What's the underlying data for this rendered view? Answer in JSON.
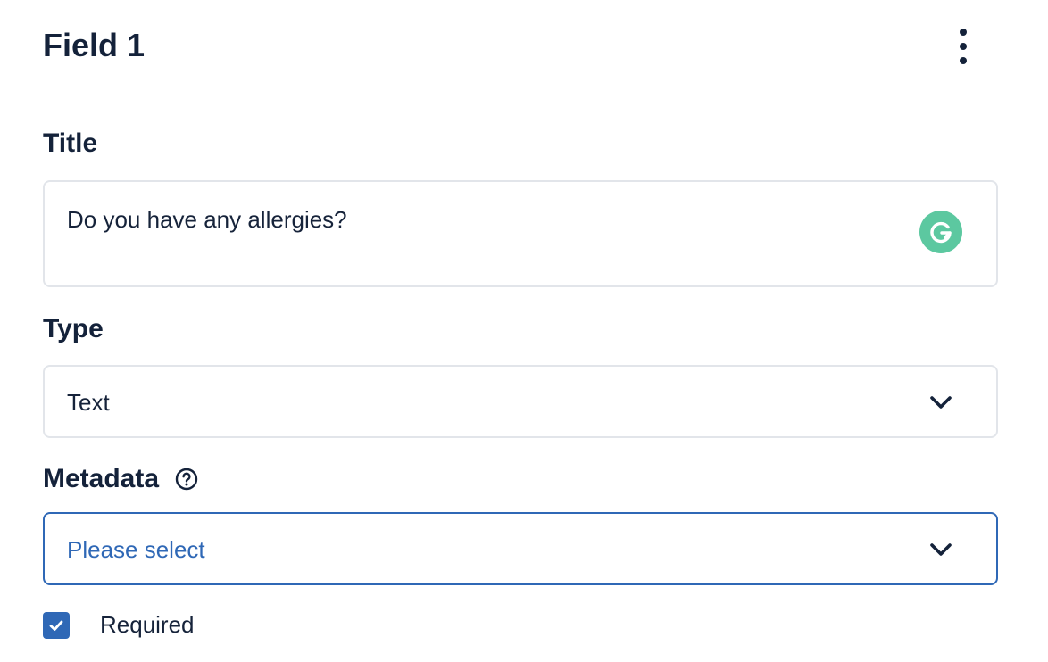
{
  "card": {
    "title": "Field 1",
    "more_icon": "kebab-menu-icon"
  },
  "title_field": {
    "label": "Title",
    "value": "Do you have any allergies?",
    "assistant_icon": "grammarly-icon",
    "assistant_color": "#5cc8a0"
  },
  "type_field": {
    "label": "Type",
    "value": "Text",
    "icon": "chevron-down-icon"
  },
  "metadata_field": {
    "label": "Metadata",
    "help_icon": "help-circle-icon",
    "placeholder": "Please select",
    "icon": "chevron-down-icon",
    "focused": true
  },
  "required": {
    "label": "Required",
    "checked": true
  },
  "colors": {
    "text": "#14223a",
    "accent": "#2f68b6",
    "border": "#e2e5ea"
  }
}
